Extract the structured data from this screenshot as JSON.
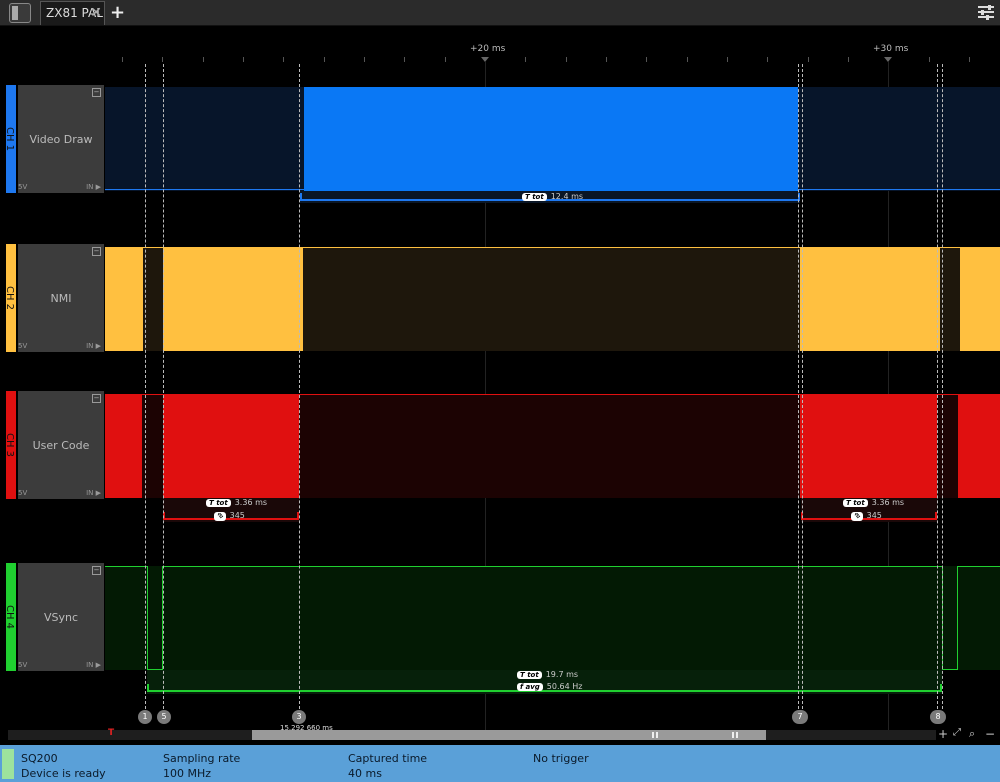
{
  "tab": {
    "title": "ZX81 PAL"
  },
  "timebar": {
    "label_20": "+20 ms",
    "label_30": "+30 ms"
  },
  "channels": [
    {
      "tag": "CH 1",
      "name": "Video Draw",
      "voltage": "5V",
      "input": "IN",
      "color": "#1e78f0"
    },
    {
      "tag": "CH 2",
      "name": "NMI",
      "voltage": "5V",
      "input": "IN",
      "color": "#ffc040"
    },
    {
      "tag": "CH 3",
      "name": "User Code",
      "voltage": "5V",
      "input": "IN",
      "color": "#e01010"
    },
    {
      "tag": "CH 4",
      "name": "VSync",
      "voltage": "5V",
      "input": "IN",
      "color": "#20d030"
    }
  ],
  "measurements": {
    "ch1_t": {
      "badge": "T tot",
      "value": "12.4 ms"
    },
    "ch3a_t": {
      "badge": "T tot",
      "value": "3.36 ms"
    },
    "ch3a_n": {
      "badge": "⮷",
      "value": "345"
    },
    "ch3b_t": {
      "badge": "T tot",
      "value": "3.36 ms"
    },
    "ch3b_n": {
      "badge": "⮷",
      "value": "345"
    },
    "ch4_t": {
      "badge": "T tot",
      "value": "19.7 ms"
    },
    "ch4_f": {
      "badge": "f avg",
      "value": "50.64 Hz"
    }
  },
  "markers": [
    "1",
    "5",
    "3",
    "7",
    "8"
  ],
  "scroll": {
    "trigger": "T",
    "time": "15.292 660 ms"
  },
  "status": {
    "device": "SQ200",
    "device_state": "Device is ready",
    "rate_label": "Sampling rate",
    "rate_value": "100 MHz",
    "captured_label": "Captured time",
    "captured_value": "40 ms",
    "trigger": "No trigger"
  }
}
